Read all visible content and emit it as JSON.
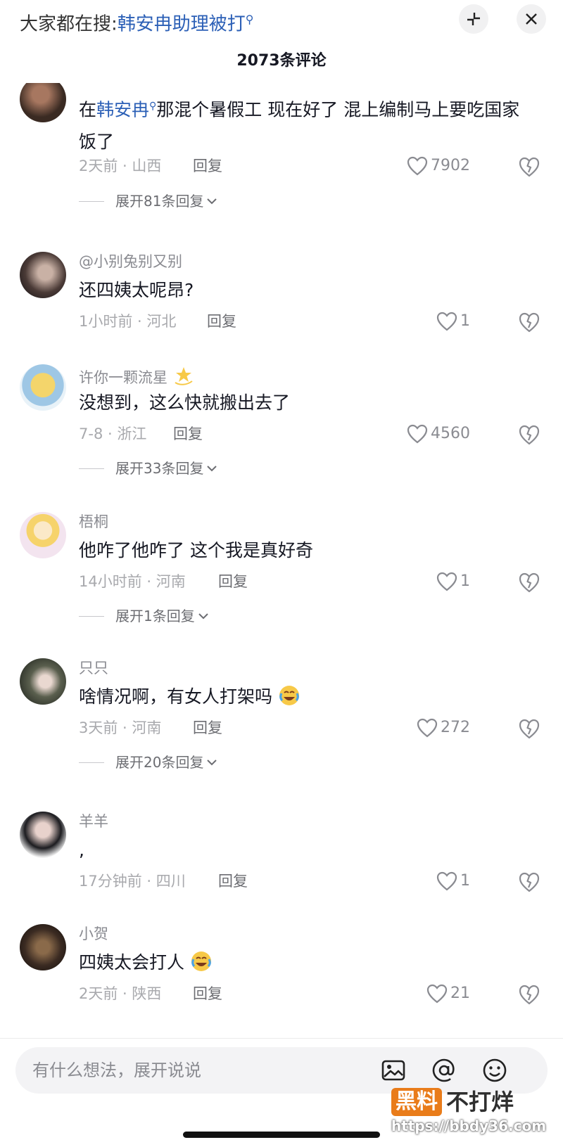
{
  "search_bar": {
    "prefix": "大家都在搜:",
    "keyword": "韩安冉助理被打"
  },
  "header": {
    "comment_count": "2073条评论"
  },
  "comments": [
    {
      "username": "",
      "text_prefix": "在",
      "text_keyword": "韩安冉",
      "text_suffix": "那混个暑假工 现在好了 混上编制马上要吃国家饭了",
      "time_location": "2天前 · 山西",
      "reply_label": "回复",
      "likes": "7902",
      "expand_label": "展开81条回复",
      "avatar_color": "#3a2a22"
    },
    {
      "username": "@小别兔别又别",
      "text": "还四姨太呢昂?",
      "time_location": "1小时前 · 河北",
      "reply_label": "回复",
      "likes": "1",
      "avatar_color": "#6a5a55"
    },
    {
      "username": "许你一颗流星",
      "username_emoji": "dizzy-star",
      "text": "没想到，这么快就搬出去了",
      "time_location": "7-8 · 浙江",
      "reply_label": "回复",
      "likes": "4560",
      "expand_label": "展开33条回复",
      "avatar_color": "#e7c76a"
    },
    {
      "username": "梧桐",
      "text": "他咋了他咋了 这个我是真好奇",
      "time_location": "14小时前 · 河南",
      "reply_label": "回复",
      "likes": "1",
      "expand_label": "展开1条回复",
      "avatar_color": "#f2e6d8"
    },
    {
      "username": "只只",
      "text": "啥情况啊，有女人打架吗",
      "text_emoji": "crying-laughing",
      "time_location": "3天前 · 河南",
      "reply_label": "回复",
      "likes": "272",
      "expand_label": "展开20条回复",
      "avatar_color": "#4b4f44"
    },
    {
      "username": "羊羊",
      "text": ",",
      "time_location": "17分钟前 · 四川",
      "reply_label": "回复",
      "likes": "1",
      "avatar_color": "#2a2a2e"
    },
    {
      "username": "小贺",
      "text": "四姨太会打人",
      "text_emoji": "crying-laughing",
      "time_location": "2天前 · 陕西",
      "reply_label": "回复",
      "likes": "21",
      "avatar_color": "#3b2b22"
    }
  ],
  "input_bar": {
    "placeholder": "有什么想法，展开说说"
  },
  "watermark": {
    "badge": "黑料",
    "rest": "不打烊",
    "url": "https://bbdy36.com"
  }
}
